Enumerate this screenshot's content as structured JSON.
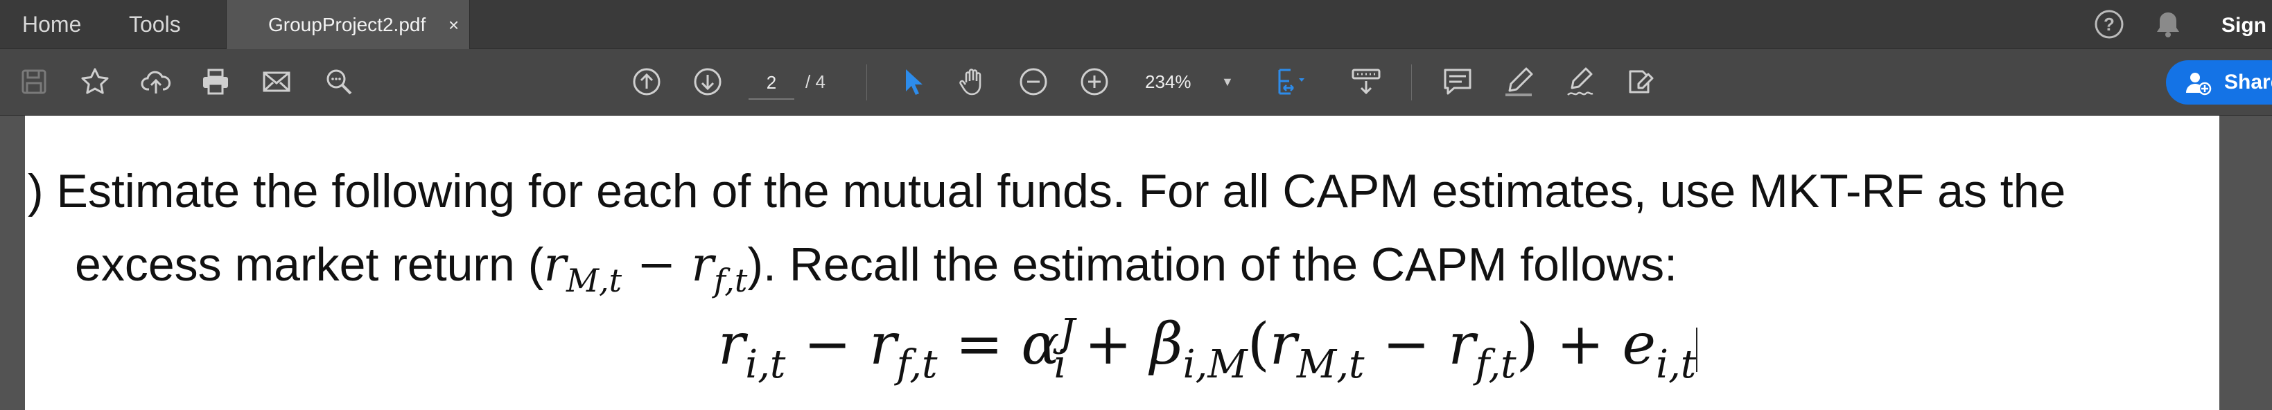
{
  "tabbar": {
    "home_label": "Home",
    "tools_label": "Tools",
    "active_tab": {
      "title": "GroupProject2.pdf",
      "close_glyph": "×"
    },
    "help_icon": "help-icon",
    "notifications_icon": "bell-icon",
    "sign_label": "Sign"
  },
  "toolbar": {
    "left_icons": [
      "save-icon",
      "star-icon",
      "cloud-upload-icon",
      "print-icon",
      "mail-icon",
      "search-icon"
    ],
    "page": {
      "current": "2",
      "total": "/ 4"
    },
    "zoom": "234%",
    "share_label": "Share",
    "accent_color": "#1473e6"
  },
  "document": {
    "line1": ")  Estimate the following for each of the mutual funds.  For all CAPM estimates, use MKT-RF as the",
    "line2_start": "excess market return (",
    "line2_end": ").  Recall the estimation of the CAPM follows:"
  }
}
